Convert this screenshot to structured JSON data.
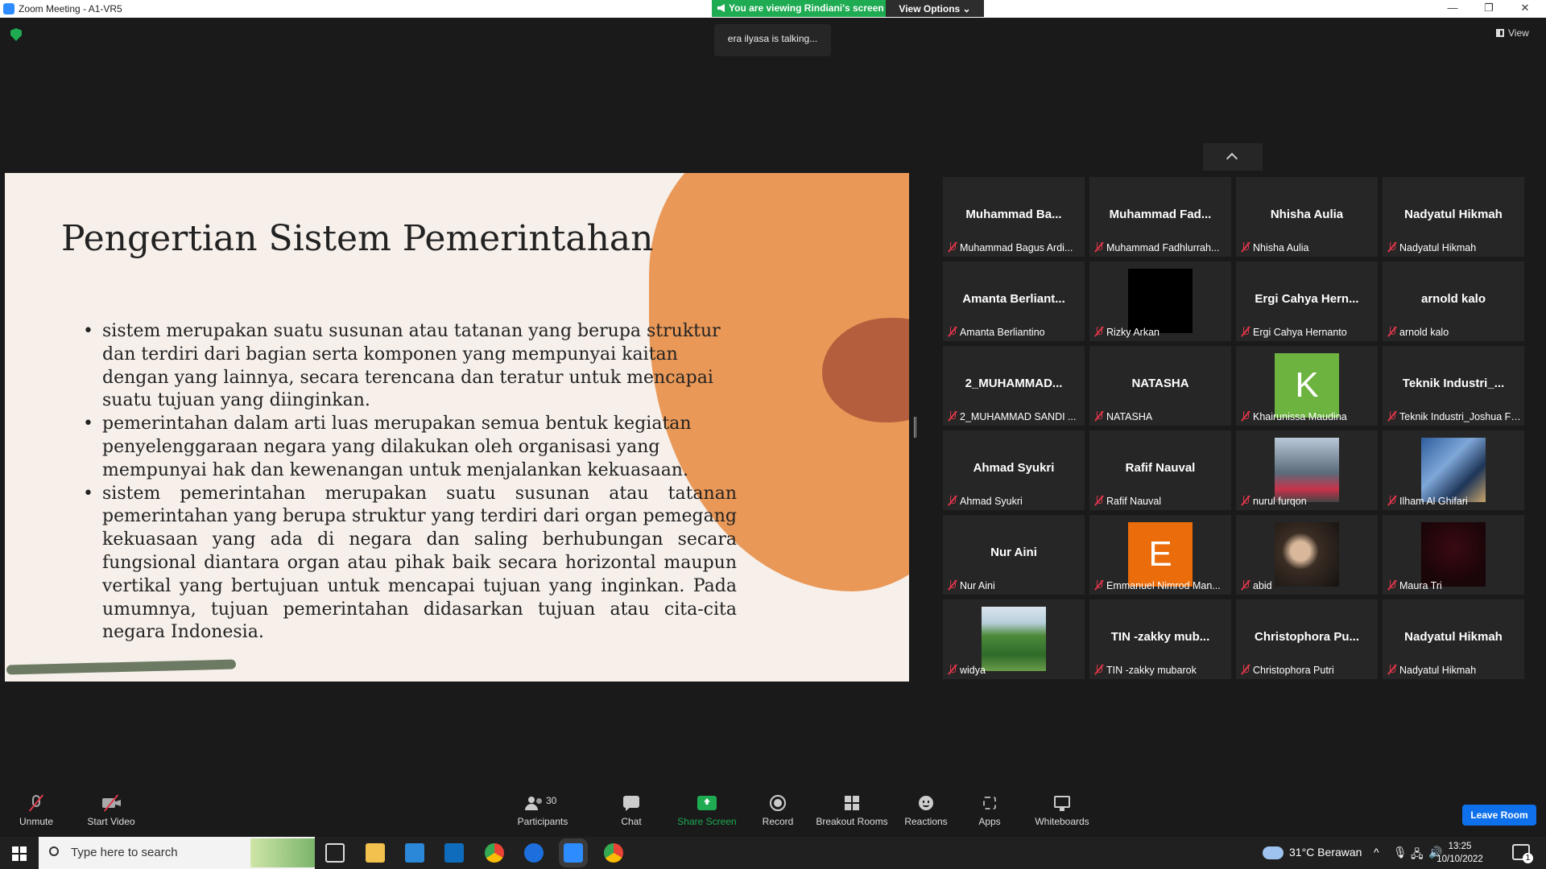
{
  "window": {
    "title": "Zoom Meeting - A1-VR5",
    "minimize": "—",
    "restore": "❐",
    "close": "✕"
  },
  "banner": {
    "viewing": "You are viewing Rindiani's screen",
    "view_options": "View Options ⌄"
  },
  "talking": "era ilyasa is talking...",
  "view_button": "View",
  "slide": {
    "title": "Pengertian Sistem Pemerintahan",
    "bullets": [
      "sistem merupakan suatu susunan atau tatanan yang berupa struktur dan terdiri dari bagian serta komponen yang mempunyai kaitan dengan yang lainnya, secara terencana dan teratur untuk mencapai suatu tujuan yang diinginkan.",
      "pemerintahan dalam arti luas merupakan semua bentuk kegiatan penyelenggaraan negara yang dilakukan oleh organisasi yang mempunyai hak dan kewenangan untuk menjalankan kekuasaan.",
      "sistem pemerintahan merupakan suatu susunan atau tatanan pemerintahan yang berupa struktur yang terdiri dari organ pemegang kekuasaan yang ada di negara dan saling berhubungan secara fungsional diantara organ atau pihak baik secara horizontal maupun vertikal yang bertujuan untuk mencapai tujuan yang inginkan. Pada umumnya, tujuan pemerintahan didasarkan tujuan atau cita-cita negara Indonesia."
    ]
  },
  "participants": [
    {
      "big": "Muhammad  Ba...",
      "name": "Muhammad Bagus Ardi..."
    },
    {
      "big": "Muhammad  Fad...",
      "name": "Muhammad Fadhlurrah..."
    },
    {
      "big": "Nhisha Aulia",
      "name": "Nhisha Aulia"
    },
    {
      "big": "Nadyatul Hikmah",
      "name": "Nadyatul Hikmah"
    },
    {
      "big": "Amanta  Berliant...",
      "name": "Amanta Berliantino"
    },
    {
      "big": "",
      "name": "Rizky Arkan",
      "media": "black"
    },
    {
      "big": "Ergi  Cahya  Hern...",
      "name": "Ergi Cahya Hernanto"
    },
    {
      "big": "arnold kalo",
      "name": "arnold kalo"
    },
    {
      "big": "2_MUHAMMAD...",
      "name": "2_MUHAMMAD SANDI ..."
    },
    {
      "big": "NATASHA",
      "name": "NATASHA"
    },
    {
      "big": "",
      "name": "Khairunissa Maudina",
      "media": "avatar",
      "letter": "K",
      "color": "#6cb33f"
    },
    {
      "big": "Teknik  Industri_...",
      "name": "Teknik Industri_Joshua Fr..."
    },
    {
      "big": "Ahmad Syukri",
      "name": "Ahmad Syukri"
    },
    {
      "big": "Rafif Nauval",
      "name": "Rafif Nauval"
    },
    {
      "big": "",
      "name": "nurul furqon",
      "media": "photo-rider"
    },
    {
      "big": "",
      "name": "Ilham Al Ghifari",
      "media": "photo-poster"
    },
    {
      "big": "Nur Aini",
      "name": "Nur Aini"
    },
    {
      "big": "",
      "name": "Emmanuel Nimrod Man...",
      "media": "avatar",
      "letter": "E",
      "color": "#ea6c0a"
    },
    {
      "big": "",
      "name": "abid",
      "media": "photo-selfie"
    },
    {
      "big": "",
      "name": "Maura Tri",
      "media": "photo-dark"
    },
    {
      "big": "",
      "name": "widya",
      "media": "photo-landscape"
    },
    {
      "big": "TIN  -zakky  mub...",
      "name": "TIN -zakky mubarok"
    },
    {
      "big": "Christophora  Pu...",
      "name": "Christophora Putri"
    },
    {
      "big": "Nadyatul Hikmah",
      "name": "Nadyatul Hikmah"
    }
  ],
  "toolbar": {
    "unmute": "Unmute",
    "start_video": "Start Video",
    "participants_count": "30",
    "participants": "Participants",
    "chat": "Chat",
    "share_screen": "Share Screen",
    "record": "Record",
    "breakout_rooms": "Breakout Rooms",
    "reactions": "Reactions",
    "apps": "Apps",
    "whiteboards": "Whiteboards",
    "leave_room": "Leave Room"
  },
  "taskbar": {
    "search_placeholder": "Type here to search",
    "weather": "31°C  Berawan",
    "time": "13:25",
    "date": "10/10/2022",
    "notification_count": "1"
  },
  "colors": {
    "share_green": "#1eab52",
    "leave_blue": "#0e71eb",
    "muted_red": "#e0364a"
  }
}
